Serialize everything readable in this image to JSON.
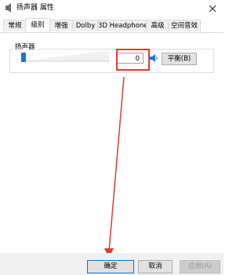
{
  "window": {
    "title": "扬声器 属性",
    "icons": {
      "app": "speaker-icon",
      "close": "close-icon"
    }
  },
  "tabs": [
    {
      "label": "常规",
      "active": false
    },
    {
      "label": "级别",
      "active": true
    },
    {
      "label": "增强",
      "active": false
    },
    {
      "label": "Dolby",
      "active": false
    },
    {
      "label": "3D Headphone",
      "active": false
    },
    {
      "label": "高级",
      "active": false
    },
    {
      "label": "空间音效",
      "active": false
    }
  ],
  "levels": {
    "group_label": "扬声器",
    "volume_value": "0",
    "volume_level": 0,
    "speaker_icon": "speaker-icon",
    "balance_label": "平衡(B)"
  },
  "buttons": {
    "ok": "确定",
    "cancel": "取消",
    "apply": "应用(A)"
  },
  "colors": {
    "accent": "#1e73d8",
    "annotation_red": "#e53935"
  }
}
